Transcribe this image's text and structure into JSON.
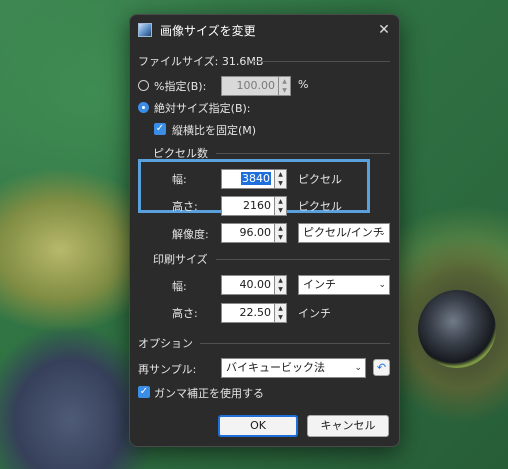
{
  "dialog": {
    "title": "画像サイズを変更",
    "close_glyph": "✕",
    "file_size_label": "ファイルサイズ: 31.6MB"
  },
  "mode": {
    "percent_label": "%指定(B):",
    "percent_value": "100.00",
    "percent_unit": "%",
    "percent_selected": false,
    "absolute_label": "絶対サイズ指定(B):",
    "absolute_selected": true,
    "keep_ratio_label": "縦横比を固定(M)",
    "keep_ratio_checked": true
  },
  "pixel_size": {
    "section_label": "ピクセル数",
    "width_label": "幅:",
    "width_value": "3840",
    "width_unit": "ピクセル",
    "height_label": "高さ:",
    "height_value": "2160",
    "height_unit": "ピクセル"
  },
  "resolution": {
    "label": "解像度:",
    "value": "96.00",
    "unit_select": "ピクセル/インチ"
  },
  "print_size": {
    "section_label": "印刷サイズ",
    "width_label": "幅:",
    "width_value": "40.00",
    "width_unit_select": "インチ",
    "height_label": "高さ:",
    "height_value": "22.50",
    "height_unit": "インチ"
  },
  "options": {
    "section_label": "オプション",
    "resample_label": "再サンプル:",
    "resample_select": "バイキュービック法",
    "gamma_label": "ガンマ補正を使用する",
    "gamma_checked": true
  },
  "buttons": {
    "ok": "OK",
    "cancel": "キャンセル"
  },
  "icons": {
    "spin_up": "▲",
    "spin_down": "▼",
    "dropdown": "⌄",
    "check": "✓",
    "reset": "↶"
  },
  "colors": {
    "accent": "#3a8ee6",
    "highlight_frame": "#5aa0dc",
    "dialog_bg": "#2b2b2b"
  }
}
